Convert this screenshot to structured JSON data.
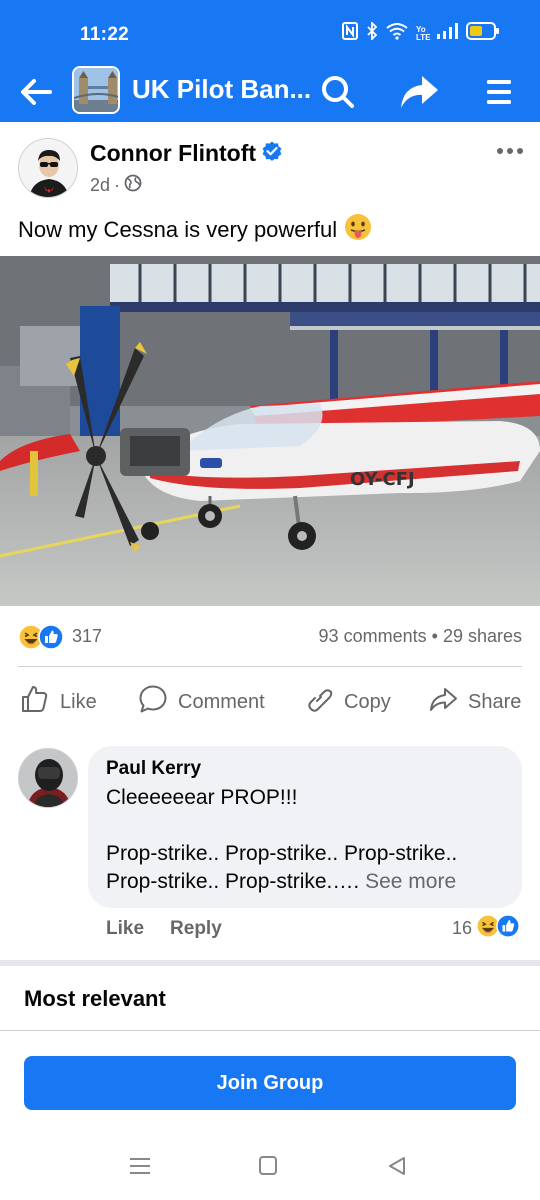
{
  "status_bar": {
    "time": "11:22",
    "icons": [
      "nfc-icon",
      "bluetooth-icon",
      "wifi-icon",
      "volte-icon",
      "signal-icon",
      "battery-icon"
    ],
    "volte_text": "Yo LTE"
  },
  "app_bar": {
    "group_title": "UK Pilot Ban...",
    "icons": [
      "back-arrow-icon",
      "search-icon",
      "share-forward-icon",
      "menu-icon"
    ]
  },
  "post": {
    "author": "Connor Flintoft",
    "verified": true,
    "time": "2d",
    "separator": "·",
    "audience_icon": "globe-icon",
    "text": "Now my Cessna is very powerful",
    "text_emoji": "😛",
    "photo_registration": "OY-CFJ",
    "reaction_count": "317",
    "comments": "93 comments",
    "dot": "•",
    "shares": "29 shares"
  },
  "actions": {
    "like": "Like",
    "comment": "Comment",
    "copy": "Copy",
    "share": "Share"
  },
  "comment": {
    "name": "Paul Kerry",
    "line1": "Cleeeeeear PROP!!!",
    "line2": "Prop-strike.. Prop-strike.. Prop-strike..",
    "line3": "Prop-strike.. Prop-strike.….",
    "see_more": "See more",
    "like": "Like",
    "reply": "Reply",
    "reaction_count": "16"
  },
  "sort_label": "Most relevant",
  "join_button": "Join Group",
  "colors": {
    "brand_blue": "#1877f2",
    "secondary_text": "#65676b",
    "bubble_bg": "#f0f2f5"
  }
}
